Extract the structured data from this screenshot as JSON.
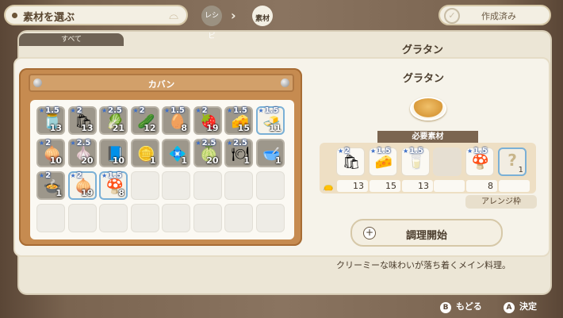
{
  "header": {
    "title": "素材を選ぶ",
    "nav_recipe": "レシピ",
    "nav_material": "素材",
    "crafted_label": "作成済み"
  },
  "background": {
    "tab_all": "すべて",
    "dish_title": "グラタン",
    "description": "クリーミーな味わいが落ち着くメイン料理。"
  },
  "bag": {
    "title": "カバン",
    "items": [
      {
        "icon": "jar",
        "glyph": "🫙",
        "star": "1.5",
        "qty": "13",
        "state": "filled"
      },
      {
        "icon": "bag",
        "glyph": "🛍",
        "star": "2",
        "qty": "13",
        "state": "filled"
      },
      {
        "icon": "cabbage",
        "glyph": "🥬",
        "star": "2.5",
        "qty": "21",
        "state": "filled"
      },
      {
        "icon": "leek",
        "glyph": "🥒",
        "star": "2",
        "qty": "12",
        "state": "filled"
      },
      {
        "icon": "egg",
        "glyph": "🥚",
        "star": "1.5",
        "qty": "8",
        "state": "filled"
      },
      {
        "icon": "strawberry",
        "glyph": "🍓",
        "star": "2",
        "qty": "19",
        "state": "filled"
      },
      {
        "icon": "cheese",
        "glyph": "🧀",
        "star": "1.5",
        "qty": "15",
        "state": "filled"
      },
      {
        "icon": "butter",
        "glyph": "🧈",
        "star": "1.5",
        "qty": "11",
        "state": "sel"
      },
      {
        "icon": "onion",
        "glyph": "🧅",
        "star": "2",
        "qty": "10",
        "state": "filled"
      },
      {
        "icon": "radish",
        "glyph": "🧄",
        "star": "2.5",
        "qty": "20",
        "state": "filled"
      },
      {
        "icon": "book",
        "glyph": "📘",
        "star": "",
        "qty": "10",
        "state": "filled"
      },
      {
        "icon": "coin",
        "glyph": "🪙",
        "star": "",
        "qty": "1",
        "state": "filled"
      },
      {
        "icon": "badge",
        "glyph": "💠",
        "star": "",
        "qty": "1",
        "state": "filled"
      },
      {
        "icon": "melon",
        "glyph": "🍈",
        "star": "2.5",
        "qty": "20",
        "state": "filled"
      },
      {
        "icon": "plate",
        "glyph": "🍽",
        "star": "2.5",
        "qty": "1",
        "state": "filled"
      },
      {
        "icon": "bowl",
        "glyph": "🥣",
        "star": "",
        "qty": "1",
        "state": "filled"
      },
      {
        "icon": "dish",
        "glyph": "🍲",
        "star": "2",
        "qty": "1",
        "state": "filled"
      },
      {
        "icon": "onion",
        "glyph": "🧅",
        "star": "2",
        "qty": "19",
        "state": "sel"
      },
      {
        "icon": "mushroom",
        "glyph": "🍄",
        "star": "1.5",
        "qty": "8",
        "state": "sel"
      },
      {
        "icon": "",
        "glyph": "",
        "star": "",
        "qty": "",
        "state": "empty"
      },
      {
        "icon": "",
        "glyph": "",
        "star": "",
        "qty": "",
        "state": "empty"
      },
      {
        "icon": "",
        "glyph": "",
        "star": "",
        "qty": "",
        "state": "empty"
      },
      {
        "icon": "",
        "glyph": "",
        "star": "",
        "qty": "",
        "state": "empty"
      },
      {
        "icon": "",
        "glyph": "",
        "star": "",
        "qty": "",
        "state": "empty"
      },
      {
        "icon": "",
        "glyph": "",
        "star": "",
        "qty": "",
        "state": "empty"
      },
      {
        "icon": "",
        "glyph": "",
        "star": "",
        "qty": "",
        "state": "empty"
      },
      {
        "icon": "",
        "glyph": "",
        "star": "",
        "qty": "",
        "state": "empty"
      },
      {
        "icon": "",
        "glyph": "",
        "star": "",
        "qty": "",
        "state": "empty"
      },
      {
        "icon": "",
        "glyph": "",
        "star": "",
        "qty": "",
        "state": "empty"
      },
      {
        "icon": "",
        "glyph": "",
        "star": "",
        "qty": "",
        "state": "empty"
      },
      {
        "icon": "",
        "glyph": "",
        "star": "",
        "qty": "",
        "state": "empty"
      },
      {
        "icon": "",
        "glyph": "",
        "star": "",
        "qty": "",
        "state": "empty"
      }
    ]
  },
  "recipe": {
    "title": "グラタン",
    "required_label": "必要素材",
    "ingredients": [
      {
        "icon": "flour",
        "glyph": "🛍",
        "star": "2",
        "have": "13"
      },
      {
        "icon": "cheese",
        "glyph": "🧀",
        "star": "1.5",
        "have": "15"
      },
      {
        "icon": "milk",
        "glyph": "🥛",
        "star": "1.5",
        "have": "13"
      },
      {
        "icon": "",
        "glyph": "",
        "star": "",
        "have": ""
      },
      {
        "icon": "mushroom",
        "glyph": "🍄",
        "star": "1.5",
        "have": "8"
      }
    ],
    "arrange_count": "1",
    "arrange_mark": "?",
    "arrange_label": "アレンジ枠",
    "cook_label": "調理開始",
    "cook_plus": "+"
  },
  "footer": {
    "back_key": "B",
    "back_label": "もどる",
    "ok_key": "A",
    "ok_label": "決定"
  }
}
